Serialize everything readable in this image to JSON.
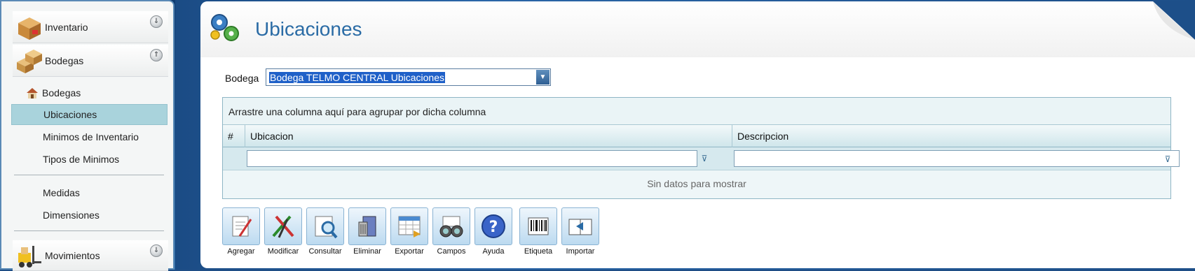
{
  "sidebar": {
    "sections": [
      {
        "label": "Inventario",
        "collapse_glyph": "⇓"
      },
      {
        "label": "Bodegas",
        "collapse_glyph": "⇑"
      },
      {
        "label": "Movimientos",
        "collapse_glyph": "⇓"
      }
    ],
    "items": [
      {
        "label": "Bodegas"
      },
      {
        "label": "Ubicaciones"
      },
      {
        "label": "Minimos de Inventario"
      },
      {
        "label": "Tipos de Minimos"
      },
      {
        "label": "Medidas"
      },
      {
        "label": "Dimensiones"
      }
    ]
  },
  "main": {
    "title": "Ubicaciones",
    "bodega_label": "Bodega",
    "bodega_value": "Bodega TELMO CENTRAL Ubicaciones",
    "grid": {
      "group_hint": "Arrastre una columna aquí para agrupar por dicha columna",
      "columns": [
        "#",
        "Ubicacion",
        "Descripcion"
      ],
      "empty_text": "Sin datos para mostrar"
    },
    "toolbar": [
      {
        "label": "Agregar",
        "icon": "add-document-icon"
      },
      {
        "label": "Modificar",
        "icon": "pencils-icon"
      },
      {
        "label": "Consultar",
        "icon": "magnifier-icon"
      },
      {
        "label": "Eliminar",
        "icon": "recycle-bin-icon"
      },
      {
        "label": "Exportar",
        "icon": "spreadsheet-export-icon"
      },
      {
        "label": "Campos",
        "icon": "binoculars-icon"
      },
      {
        "label": "Ayuda",
        "icon": "help-icon"
      },
      {
        "label": "Etiqueta",
        "icon": "barcode-icon"
      },
      {
        "label": "Importar",
        "icon": "import-icon"
      }
    ]
  },
  "colors": {
    "accent": "#2a6ba5",
    "selected_item": "#a9d3dc",
    "grid_header": "#cfe6eb"
  }
}
